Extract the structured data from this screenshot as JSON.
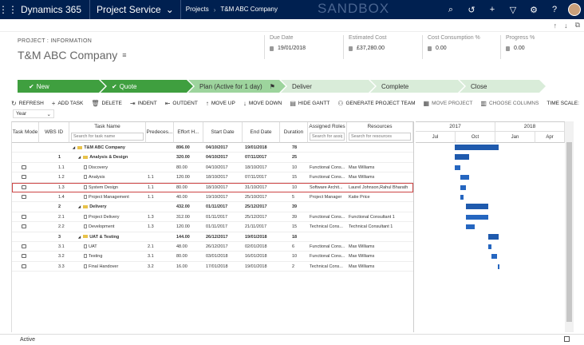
{
  "nav": {
    "brand": "Dynamics 365",
    "module": "Project Service",
    "crumb1": "Projects",
    "crumb2": "T&M ABC Company",
    "sandbox": "SANDBOX"
  },
  "header": {
    "entity": "PROJECT : INFORMATION",
    "title": "T&M ABC Company",
    "fields": [
      {
        "label": "Due Date",
        "value": "19/01/2018"
      },
      {
        "label": "Estimated Cost",
        "value": "£37,280.00"
      },
      {
        "label": "Cost Consumption %",
        "value": "0.00"
      },
      {
        "label": "Progress %",
        "value": "0.00"
      }
    ]
  },
  "stages": [
    {
      "label": "New",
      "state": "done"
    },
    {
      "label": "Quote",
      "state": "done"
    },
    {
      "label": "Plan (Active for 1 day)",
      "state": "active"
    },
    {
      "label": "Deliver",
      "state": "todo"
    },
    {
      "label": "Complete",
      "state": "todo"
    },
    {
      "label": "Close",
      "state": "todo"
    }
  ],
  "toolbar": {
    "refresh": "REFRESH",
    "add_task": "ADD TASK",
    "delete": "DELETE",
    "indent": "INDENT",
    "outdent": "OUTDENT",
    "move_up": "MOVE UP",
    "move_down": "MOVE DOWN",
    "hide_gantt": "HIDE GANTT",
    "generate_team": "GENERATE PROJECT TEAM",
    "move_project": "MOVE PROJECT",
    "choose_columns": "CHOOSE COLUMNS",
    "time_scale": "TIME SCALE:"
  },
  "scale": {
    "value": "Year"
  },
  "columns": {
    "mode": "Task Mode",
    "wbs": "WBS ID",
    "task": "Task Name",
    "pred": "Predeces...",
    "effort": "Effort H...",
    "start": "Start Date",
    "end": "End Date",
    "duration": "Duration",
    "roles": "Assigned Roles",
    "resources": "Resources"
  },
  "search": {
    "task": "Search for task name",
    "roles": "Search for assign",
    "resources": "Search for resources"
  },
  "rows": [
    {
      "wbs": "",
      "name": "T&M ABC Company",
      "pred": "",
      "effort": "896.00",
      "start": "04/10/2017",
      "end": "19/01/2018",
      "dur": "78",
      "roles": "",
      "res": "",
      "level": 0,
      "summary": true
    },
    {
      "wbs": "1",
      "name": "Analysis & Design",
      "pred": "",
      "effort": "320.00",
      "start": "04/10/2017",
      "end": "07/11/2017",
      "dur": "25",
      "roles": "",
      "res": "",
      "level": 1,
      "summary": true
    },
    {
      "wbs": "1.1",
      "name": "Discovery",
      "pred": "",
      "effort": "80.00",
      "start": "04/10/2017",
      "end": "18/10/2017",
      "dur": "10",
      "roles": "Functional Cons...",
      "res": "Max Williams",
      "level": 2,
      "summary": false
    },
    {
      "wbs": "1.2",
      "name": "Analysis",
      "pred": "1.1",
      "effort": "120.00",
      "start": "18/10/2017",
      "end": "07/11/2017",
      "dur": "15",
      "roles": "Functional Cons...",
      "res": "Max Williams",
      "level": 2,
      "summary": false
    },
    {
      "wbs": "1.3",
      "name": "System Design",
      "pred": "1.1",
      "effort": "80.00",
      "start": "18/10/2017",
      "end": "31/10/2017",
      "dur": "10",
      "roles": "Software Archit...",
      "res": "Laurel Johnson,Rahul Bharath",
      "level": 2,
      "summary": false,
      "selected": true
    },
    {
      "wbs": "1.4",
      "name": "Project Management",
      "pred": "1.1",
      "effort": "40.00",
      "start": "19/10/2017",
      "end": "25/10/2017",
      "dur": "5",
      "roles": "Project Manager",
      "res": "Katie Price",
      "level": 2,
      "summary": false
    },
    {
      "wbs": "2",
      "name": "Delivery",
      "pred": "",
      "effort": "432.00",
      "start": "01/11/2017",
      "end": "25/12/2017",
      "dur": "39",
      "roles": "",
      "res": "",
      "level": 1,
      "summary": true
    },
    {
      "wbs": "2.1",
      "name": "Project Delivery",
      "pred": "1.3",
      "effort": "312.00",
      "start": "01/11/2017",
      "end": "25/12/2017",
      "dur": "39",
      "roles": "Functional Cons...",
      "res": "Functional Consultant 1",
      "level": 2,
      "summary": false
    },
    {
      "wbs": "2.2",
      "name": "Development",
      "pred": "1.3",
      "effort": "120.00",
      "start": "01/11/2017",
      "end": "21/11/2017",
      "dur": "15",
      "roles": "Technical Cons...",
      "res": "Technical Consultant 1",
      "level": 2,
      "summary": false
    },
    {
      "wbs": "3",
      "name": "UAT & Testing",
      "pred": "",
      "effort": "144.00",
      "start": "26/12/2017",
      "end": "19/01/2018",
      "dur": "18",
      "roles": "",
      "res": "",
      "level": 1,
      "summary": true
    },
    {
      "wbs": "3.1",
      "name": "UAT",
      "pred": "2.1",
      "effort": "48.00",
      "start": "26/12/2017",
      "end": "02/01/2018",
      "dur": "6",
      "roles": "Functional Cons...",
      "res": "Max Williams",
      "level": 2,
      "summary": false
    },
    {
      "wbs": "3.2",
      "name": "Testing",
      "pred": "3.1",
      "effort": "80.00",
      "start": "03/01/2018",
      "end": "16/01/2018",
      "dur": "10",
      "roles": "Functional Cons...",
      "res": "Max Williams",
      "level": 2,
      "summary": false
    },
    {
      "wbs": "3.3",
      "name": "Final Handover",
      "pred": "3.2",
      "effort": "16.00",
      "start": "17/01/2018",
      "end": "19/01/2018",
      "dur": "2",
      "roles": "Technical Cons...",
      "res": "Max Williams",
      "level": 2,
      "summary": false
    }
  ],
  "gantt": {
    "years": [
      "2017",
      "2018"
    ],
    "months": [
      "Jul",
      "Oct",
      "Jan",
      "Apr"
    ]
  },
  "footer": {
    "status": "Active"
  }
}
